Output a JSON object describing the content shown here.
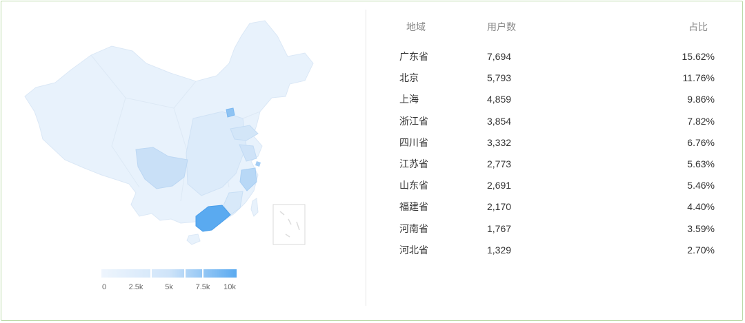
{
  "colors": {
    "border": "#b9d9a6",
    "map_base": "#e8f2fc",
    "map_mid": "#cfe3f8",
    "map_high": "#5aaaf0"
  },
  "legend": {
    "labels": [
      "0",
      "2.5k",
      "5k",
      "7.5k",
      "10k"
    ]
  },
  "table": {
    "headers": {
      "region": "地域",
      "users": "用户数",
      "share": "占比"
    }
  },
  "chart_data": {
    "type": "table",
    "columns": [
      "地域",
      "用户数",
      "占比"
    ],
    "rows": [
      {
        "region": "广东省",
        "users": "7,694",
        "share": "15.62%"
      },
      {
        "region": "北京",
        "users": "5,793",
        "share": "11.76%"
      },
      {
        "region": "上海",
        "users": "4,859",
        "share": "9.86%"
      },
      {
        "region": "浙江省",
        "users": "3,854",
        "share": "7.82%"
      },
      {
        "region": "四川省",
        "users": "3,332",
        "share": "6.76%"
      },
      {
        "region": "江苏省",
        "users": "2,773",
        "share": "5.63%"
      },
      {
        "region": "山东省",
        "users": "2,691",
        "share": "5.46%"
      },
      {
        "region": "福建省",
        "users": "2,170",
        "share": "4.40%"
      },
      {
        "region": "河南省",
        "users": "1,767",
        "share": "3.59%"
      },
      {
        "region": "河北省",
        "users": "1,329",
        "share": "2.70%"
      }
    ],
    "color_scale": {
      "min": 0,
      "max": 10000
    }
  }
}
